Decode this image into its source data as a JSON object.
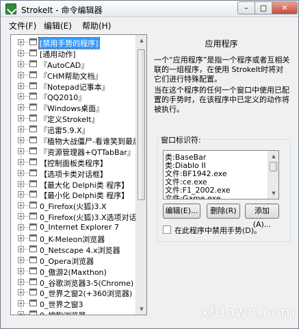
{
  "window": {
    "title": "StrokeIt - 命令编辑器",
    "controls": {
      "minimize": "–",
      "maximize": "□",
      "close": "✕"
    }
  },
  "menubar": [
    {
      "label": "文件(F)"
    },
    {
      "label": "编辑(E)"
    },
    {
      "label": "帮助(H)"
    }
  ],
  "tree": {
    "items": [
      {
        "label": "[禁用手势的程序]",
        "selected": true
      },
      {
        "label": "[通用动作]"
      },
      {
        "label": "『AutoCAD』"
      },
      {
        "label": "『CHM帮助文档』"
      },
      {
        "label": "『Notepad记事本』"
      },
      {
        "label": "『QQ2010』"
      },
      {
        "label": "『Windows桌面』"
      },
      {
        "label": "『定义StrokeIt』"
      },
      {
        "label": "『迅雷5.9.X』"
      },
      {
        "label": "『植物大战僵尸-看谁笑到最后"
      },
      {
        "label": "『资源管理器+QTTabBar』"
      },
      {
        "label": "【控制面板类程序】"
      },
      {
        "label": "【选项卡类对话框】"
      },
      {
        "label": "【最大化 Delphi类 程序】"
      },
      {
        "label": "【最小化 Delphi类 程序】"
      },
      {
        "label": "0_Firefox(火狐)3.X"
      },
      {
        "label": "0_Firefox(火狐)3.X选项对话框"
      },
      {
        "label": "0_Internet Explorer 7"
      },
      {
        "label": "0_K-Meleon浏览器"
      },
      {
        "label": "0_Netscape 4.x浏览器"
      },
      {
        "label": "0_Opera浏览器"
      },
      {
        "label": "0_傲游2(Maxthon)"
      },
      {
        "label": "0_谷歌浏览器3-5(Chrome)"
      },
      {
        "label": "0_世界之窗2(+360浏览器)"
      },
      {
        "label": "0_世界之窗3"
      },
      {
        "label": "0_搜狗浏览器"
      },
      {
        "label": "1_Kmplayer播放器"
      },
      {
        "label": "1_Media Player播放器"
      }
    ]
  },
  "detail": {
    "heading": "应用程序",
    "paragraph1": "一个“应用程序”是指一个程序或者互相关联的一组程序，在使用 StrokeIt时将对它们进行特殊配置。",
    "paragraph2": "当在这个程序的任何一个窗口中使用已配置的手势时，在该程序中已定义的动作将被执行。",
    "window_identifiers": {
      "group_label": "窗口标识符:",
      "items": [
        "类:BaseBar",
        "类:Diablo II",
        "文件:BF1942.exe",
        "文件:ce.exe",
        "文件:F1_2002.exe",
        "文件:Game.exe"
      ],
      "edit_label": "编辑(E)...",
      "delete_label": "删除(R)",
      "add_label": "添加(A)...",
      "disable_checkbox_label": "在此程序中禁用手势(D)。",
      "disable_checked": false
    }
  },
  "watermark": "xfdown.com"
}
